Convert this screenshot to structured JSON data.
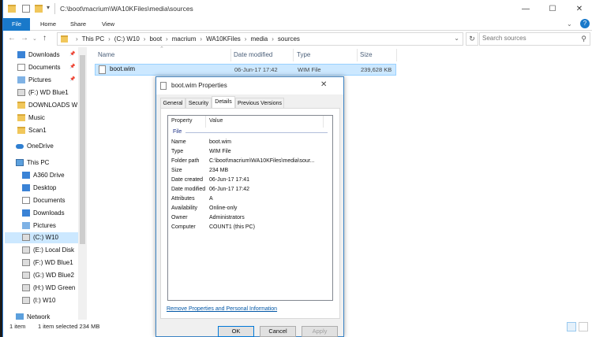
{
  "window": {
    "title_path": "C:\\boot\\macrium\\WA10KFiles\\media\\sources",
    "controls": {
      "minimize": "—",
      "maximize": "☐",
      "close": "✕"
    }
  },
  "ribbon": {
    "tabs": [
      "File",
      "Home",
      "Share",
      "View"
    ],
    "help": "?"
  },
  "address": {
    "crumbs": [
      "This PC",
      "(C:) W10",
      "boot",
      "macrium",
      "WA10KFiles",
      "media",
      "sources"
    ],
    "search_placeholder": "Search sources"
  },
  "nav": {
    "quick_access": [
      {
        "label": "Downloads",
        "pinned": true
      },
      {
        "label": "Documents",
        "pinned": true
      },
      {
        "label": "Pictures",
        "pinned": true
      },
      {
        "label": "(F:) WD Blue1"
      },
      {
        "label": "DOWNLOADS W"
      },
      {
        "label": "Music"
      },
      {
        "label": "Scan1"
      }
    ],
    "onedrive": "OneDrive",
    "this_pc": "This PC",
    "pc_items": [
      "A360 Drive",
      "Desktop",
      "Documents",
      "Downloads",
      "Pictures",
      "(C:) W10",
      "(E:) Local Disk",
      "(F:) WD Blue1",
      "(G:) WD Blue2",
      "(H:) WD Green",
      "(I:) W10"
    ],
    "network": "Network"
  },
  "files": {
    "columns": [
      "Name",
      "Date modified",
      "Type",
      "Size"
    ],
    "rows": [
      {
        "name": "boot.wim",
        "date": "06-Jun-17 17:42",
        "type": "WIM File",
        "size": "239,628 KB"
      }
    ]
  },
  "status": {
    "count": "1 item",
    "selected": "1 item selected  234 MB"
  },
  "dialog": {
    "title": "boot.wim Properties",
    "tabs": [
      "General",
      "Security",
      "Details",
      "Previous Versions"
    ],
    "active_tab": "Details",
    "headers": [
      "Property",
      "Value"
    ],
    "group": "File",
    "props": [
      {
        "k": "Name",
        "v": "boot.wim"
      },
      {
        "k": "Type",
        "v": "WIM File"
      },
      {
        "k": "Folder path",
        "v": "C:\\boot\\macrium\\WA10KFiles\\media\\sour..."
      },
      {
        "k": "Size",
        "v": "234 MB"
      },
      {
        "k": "Date created",
        "v": "06-Jun-17 17:41"
      },
      {
        "k": "Date modified",
        "v": "06-Jun-17 17:42"
      },
      {
        "k": "Attributes",
        "v": "A"
      },
      {
        "k": "Availability",
        "v": "Online-only"
      },
      {
        "k": "Owner",
        "v": "Administrators"
      },
      {
        "k": "Computer",
        "v": "COUNT1 (this PC)"
      }
    ],
    "remove_link": "Remove Properties and Personal Information",
    "buttons": {
      "ok": "OK",
      "cancel": "Cancel",
      "apply": "Apply"
    }
  }
}
